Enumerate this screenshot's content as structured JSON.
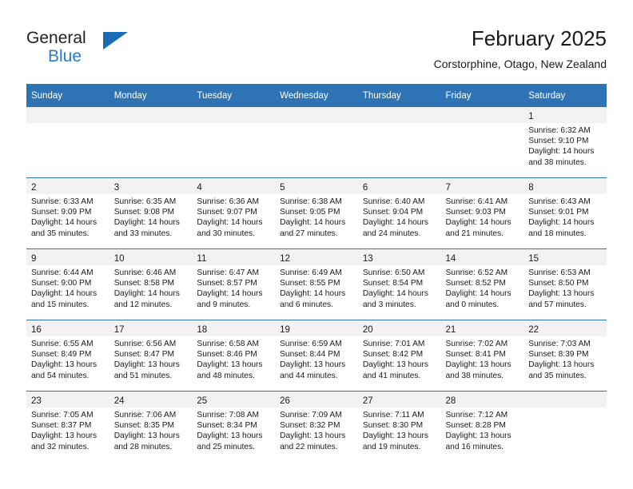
{
  "brand": {
    "name_part1": "General",
    "name_part2": "Blue",
    "logo_icon": "triangle-logo-icon",
    "accent_color": "#1a6cb5"
  },
  "header": {
    "title": "February 2025",
    "location": "Corstorphine, Otago, New Zealand"
  },
  "theme": {
    "header_blue": "#2e74b5",
    "band_gray": "#f2f2f2",
    "text": "#1a1a1a"
  },
  "weekday_headers": [
    "Sunday",
    "Monday",
    "Tuesday",
    "Wednesday",
    "Thursday",
    "Friday",
    "Saturday"
  ],
  "weeks": [
    [
      {
        "day": "",
        "sunrise": "",
        "sunset": "",
        "daylight1": "",
        "daylight2": "",
        "empty": true
      },
      {
        "day": "",
        "sunrise": "",
        "sunset": "",
        "daylight1": "",
        "daylight2": "",
        "empty": true
      },
      {
        "day": "",
        "sunrise": "",
        "sunset": "",
        "daylight1": "",
        "daylight2": "",
        "empty": true
      },
      {
        "day": "",
        "sunrise": "",
        "sunset": "",
        "daylight1": "",
        "daylight2": "",
        "empty": true
      },
      {
        "day": "",
        "sunrise": "",
        "sunset": "",
        "daylight1": "",
        "daylight2": "",
        "empty": true
      },
      {
        "day": "",
        "sunrise": "",
        "sunset": "",
        "daylight1": "",
        "daylight2": "",
        "empty": true
      },
      {
        "day": "1",
        "sunrise": "Sunrise: 6:32 AM",
        "sunset": "Sunset: 9:10 PM",
        "daylight1": "Daylight: 14 hours",
        "daylight2": "and 38 minutes.",
        "empty": false
      }
    ],
    [
      {
        "day": "2",
        "sunrise": "Sunrise: 6:33 AM",
        "sunset": "Sunset: 9:09 PM",
        "daylight1": "Daylight: 14 hours",
        "daylight2": "and 35 minutes.",
        "empty": false
      },
      {
        "day": "3",
        "sunrise": "Sunrise: 6:35 AM",
        "sunset": "Sunset: 9:08 PM",
        "daylight1": "Daylight: 14 hours",
        "daylight2": "and 33 minutes.",
        "empty": false
      },
      {
        "day": "4",
        "sunrise": "Sunrise: 6:36 AM",
        "sunset": "Sunset: 9:07 PM",
        "daylight1": "Daylight: 14 hours",
        "daylight2": "and 30 minutes.",
        "empty": false
      },
      {
        "day": "5",
        "sunrise": "Sunrise: 6:38 AM",
        "sunset": "Sunset: 9:05 PM",
        "daylight1": "Daylight: 14 hours",
        "daylight2": "and 27 minutes.",
        "empty": false
      },
      {
        "day": "6",
        "sunrise": "Sunrise: 6:40 AM",
        "sunset": "Sunset: 9:04 PM",
        "daylight1": "Daylight: 14 hours",
        "daylight2": "and 24 minutes.",
        "empty": false
      },
      {
        "day": "7",
        "sunrise": "Sunrise: 6:41 AM",
        "sunset": "Sunset: 9:03 PM",
        "daylight1": "Daylight: 14 hours",
        "daylight2": "and 21 minutes.",
        "empty": false
      },
      {
        "day": "8",
        "sunrise": "Sunrise: 6:43 AM",
        "sunset": "Sunset: 9:01 PM",
        "daylight1": "Daylight: 14 hours",
        "daylight2": "and 18 minutes.",
        "empty": false
      }
    ],
    [
      {
        "day": "9",
        "sunrise": "Sunrise: 6:44 AM",
        "sunset": "Sunset: 9:00 PM",
        "daylight1": "Daylight: 14 hours",
        "daylight2": "and 15 minutes.",
        "empty": false
      },
      {
        "day": "10",
        "sunrise": "Sunrise: 6:46 AM",
        "sunset": "Sunset: 8:58 PM",
        "daylight1": "Daylight: 14 hours",
        "daylight2": "and 12 minutes.",
        "empty": false
      },
      {
        "day": "11",
        "sunrise": "Sunrise: 6:47 AM",
        "sunset": "Sunset: 8:57 PM",
        "daylight1": "Daylight: 14 hours",
        "daylight2": "and 9 minutes.",
        "empty": false
      },
      {
        "day": "12",
        "sunrise": "Sunrise: 6:49 AM",
        "sunset": "Sunset: 8:55 PM",
        "daylight1": "Daylight: 14 hours",
        "daylight2": "and 6 minutes.",
        "empty": false
      },
      {
        "day": "13",
        "sunrise": "Sunrise: 6:50 AM",
        "sunset": "Sunset: 8:54 PM",
        "daylight1": "Daylight: 14 hours",
        "daylight2": "and 3 minutes.",
        "empty": false
      },
      {
        "day": "14",
        "sunrise": "Sunrise: 6:52 AM",
        "sunset": "Sunset: 8:52 PM",
        "daylight1": "Daylight: 14 hours",
        "daylight2": "and 0 minutes.",
        "empty": false
      },
      {
        "day": "15",
        "sunrise": "Sunrise: 6:53 AM",
        "sunset": "Sunset: 8:50 PM",
        "daylight1": "Daylight: 13 hours",
        "daylight2": "and 57 minutes.",
        "empty": false
      }
    ],
    [
      {
        "day": "16",
        "sunrise": "Sunrise: 6:55 AM",
        "sunset": "Sunset: 8:49 PM",
        "daylight1": "Daylight: 13 hours",
        "daylight2": "and 54 minutes.",
        "empty": false
      },
      {
        "day": "17",
        "sunrise": "Sunrise: 6:56 AM",
        "sunset": "Sunset: 8:47 PM",
        "daylight1": "Daylight: 13 hours",
        "daylight2": "and 51 minutes.",
        "empty": false
      },
      {
        "day": "18",
        "sunrise": "Sunrise: 6:58 AM",
        "sunset": "Sunset: 8:46 PM",
        "daylight1": "Daylight: 13 hours",
        "daylight2": "and 48 minutes.",
        "empty": false
      },
      {
        "day": "19",
        "sunrise": "Sunrise: 6:59 AM",
        "sunset": "Sunset: 8:44 PM",
        "daylight1": "Daylight: 13 hours",
        "daylight2": "and 44 minutes.",
        "empty": false
      },
      {
        "day": "20",
        "sunrise": "Sunrise: 7:01 AM",
        "sunset": "Sunset: 8:42 PM",
        "daylight1": "Daylight: 13 hours",
        "daylight2": "and 41 minutes.",
        "empty": false
      },
      {
        "day": "21",
        "sunrise": "Sunrise: 7:02 AM",
        "sunset": "Sunset: 8:41 PM",
        "daylight1": "Daylight: 13 hours",
        "daylight2": "and 38 minutes.",
        "empty": false
      },
      {
        "day": "22",
        "sunrise": "Sunrise: 7:03 AM",
        "sunset": "Sunset: 8:39 PM",
        "daylight1": "Daylight: 13 hours",
        "daylight2": "and 35 minutes.",
        "empty": false
      }
    ],
    [
      {
        "day": "23",
        "sunrise": "Sunrise: 7:05 AM",
        "sunset": "Sunset: 8:37 PM",
        "daylight1": "Daylight: 13 hours",
        "daylight2": "and 32 minutes.",
        "empty": false
      },
      {
        "day": "24",
        "sunrise": "Sunrise: 7:06 AM",
        "sunset": "Sunset: 8:35 PM",
        "daylight1": "Daylight: 13 hours",
        "daylight2": "and 28 minutes.",
        "empty": false
      },
      {
        "day": "25",
        "sunrise": "Sunrise: 7:08 AM",
        "sunset": "Sunset: 8:34 PM",
        "daylight1": "Daylight: 13 hours",
        "daylight2": "and 25 minutes.",
        "empty": false
      },
      {
        "day": "26",
        "sunrise": "Sunrise: 7:09 AM",
        "sunset": "Sunset: 8:32 PM",
        "daylight1": "Daylight: 13 hours",
        "daylight2": "and 22 minutes.",
        "empty": false
      },
      {
        "day": "27",
        "sunrise": "Sunrise: 7:11 AM",
        "sunset": "Sunset: 8:30 PM",
        "daylight1": "Daylight: 13 hours",
        "daylight2": "and 19 minutes.",
        "empty": false
      },
      {
        "day": "28",
        "sunrise": "Sunrise: 7:12 AM",
        "sunset": "Sunset: 8:28 PM",
        "daylight1": "Daylight: 13 hours",
        "daylight2": "and 16 minutes.",
        "empty": false
      },
      {
        "day": "",
        "sunrise": "",
        "sunset": "",
        "daylight1": "",
        "daylight2": "",
        "empty": true
      }
    ]
  ]
}
